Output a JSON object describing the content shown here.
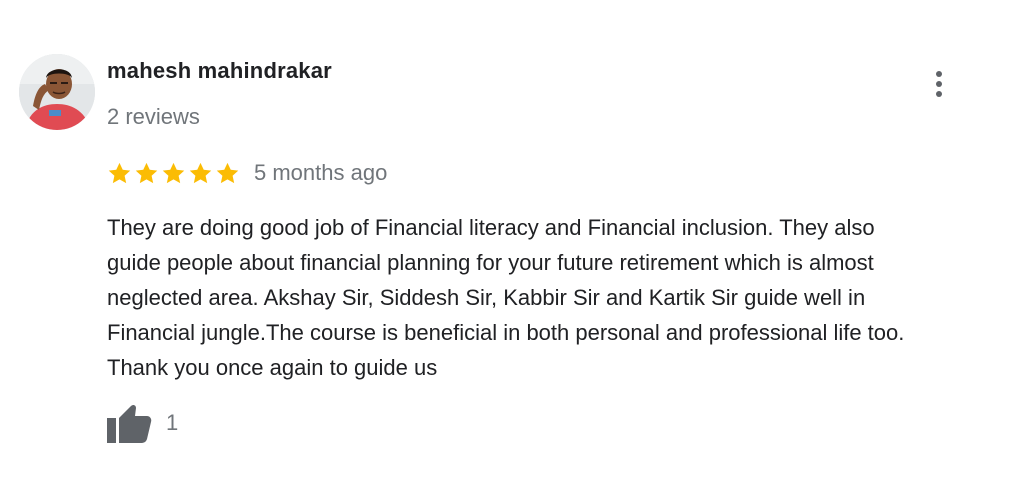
{
  "review": {
    "author": {
      "name": "mahesh mahindrakar",
      "review_count": "2 reviews"
    },
    "rating": 5,
    "rating_max": 5,
    "time": "5 months ago",
    "text": "They are doing good job of Financial literacy and Financial inclusion. They also\nguide people about financial planning for your future retirement which is almost\nneglected area. Akshay Sir, Siddesh Sir, Kabbir Sir and Kartik Sir guide well in\nFinancial jungle.The course is beneficial in both personal and professional life too.\nThank you once again to guide us",
    "likes": "1",
    "icons": {
      "more": "more-vert-icon",
      "star": "star-icon",
      "like": "thumbs-up-icon"
    },
    "colors": {
      "star": "#fbbc04",
      "secondary_text": "#70757a",
      "primary_text": "#202124",
      "icon": "#5f6368"
    }
  }
}
